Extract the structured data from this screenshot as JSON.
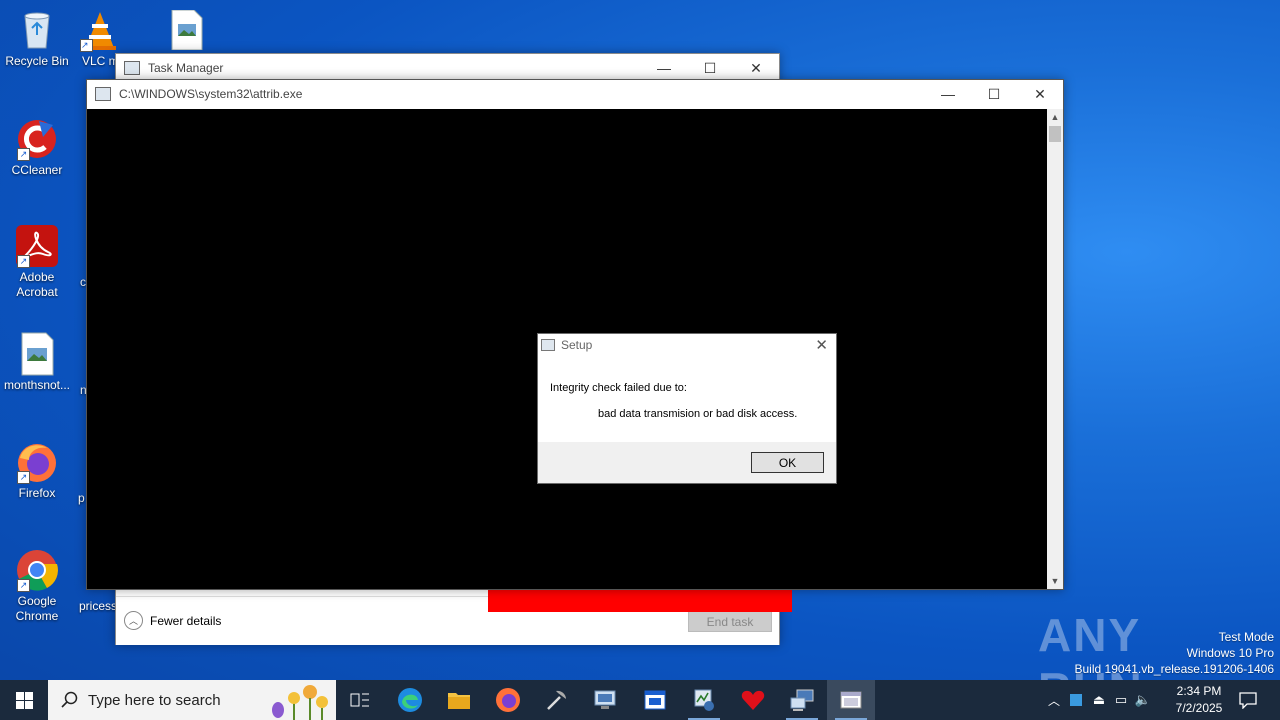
{
  "desktop": {
    "icons": [
      {
        "label": "Recycle Bin",
        "icon": "recycle-bin-icon"
      },
      {
        "label": "VLC m",
        "icon": "vlc-icon"
      },
      {
        "label": "CCleaner",
        "icon": "ccleaner-icon"
      },
      {
        "label": "Adobe Acrobat",
        "icon": "adobe-acrobat-icon"
      },
      {
        "label": "monthsnot...",
        "icon": "image-file-icon"
      },
      {
        "label": "Firefox",
        "icon": "firefox-icon"
      },
      {
        "label": "Google Chrome",
        "icon": "chrome-icon"
      }
    ],
    "clipped_labels": [
      "c",
      "n",
      "p",
      "pricess"
    ]
  },
  "task_manager": {
    "title": "Task Manager",
    "fewer_details": "Fewer details",
    "end_task": "End task"
  },
  "console": {
    "title": "C:\\WINDOWS\\system32\\attrib.exe"
  },
  "dialog": {
    "title": "Setup",
    "line1": "Integrity check failed due to:",
    "line2": "bad data transmision or bad disk access.",
    "ok": "OK"
  },
  "taskbar": {
    "search_placeholder": "Type here to search",
    "time": "2:34 PM",
    "date": "7/2/2025"
  },
  "watermark": {
    "line1": "Test Mode",
    "line2": "Windows 10 Pro",
    "line3": "Build 19041.vb_release.191206-1406",
    "brand": "ANY RUN"
  },
  "colors": {
    "desktop_bg": "#0b55c2",
    "taskbar_bg": "#1b2a3d",
    "console_bg": "#000000",
    "red_block": "#ff0000"
  }
}
